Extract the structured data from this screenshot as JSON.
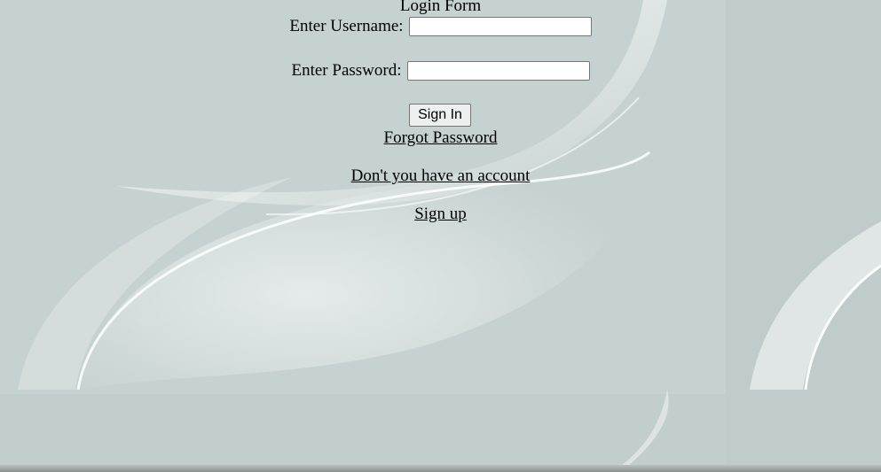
{
  "form": {
    "title": "Login Form",
    "username_label": "Enter Username:",
    "username_value": "",
    "password_label": "Enter Password:",
    "password_value": "",
    "signin_label": "Sign In"
  },
  "links": {
    "forgot_password": "Forgot Password",
    "no_account": "Don't you have an account",
    "sign_up": "Sign up"
  },
  "colors": {
    "background": "#c3cfcf",
    "text": "#000000",
    "input_background": "#ffffff",
    "button_background": "#efefef"
  }
}
